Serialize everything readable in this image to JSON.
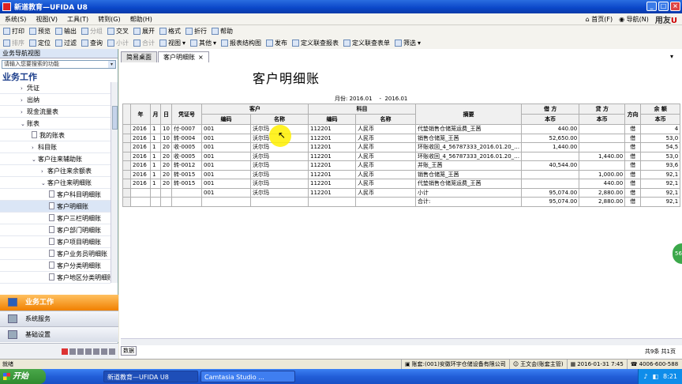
{
  "window": {
    "title": "新道教育—UFIDA U8"
  },
  "menu": [
    "系统(S)",
    "视图(V)",
    "工具(T)",
    "转到(G)",
    "帮助(H)"
  ],
  "menu_right": {
    "home": "首页(F)",
    "nav": "导航(N)",
    "logo_a": "用友",
    "logo_b": "U"
  },
  "toolbar1": [
    "打印",
    "预览",
    "输出",
    "分组",
    "交叉",
    "展开",
    "格式",
    "折行",
    "帮助"
  ],
  "toolbar2": [
    "排序",
    "定位",
    "过滤",
    "查询",
    "小计",
    "合计",
    "视图",
    "其他",
    "报表结构图",
    "发布",
    "定义联查报表",
    "定义联查表单",
    "筛选"
  ],
  "sidebar": {
    "header": "业务导航视图",
    "search_placeholder": "请输入您要搜索的功能",
    "title": "业务工作",
    "tree": [
      {
        "label": "凭证",
        "arrow": "›"
      },
      {
        "label": "出纳",
        "arrow": "›"
      },
      {
        "label": "现金流量表",
        "arrow": "›"
      },
      {
        "label": "账表",
        "arrow": "⌄"
      },
      {
        "label": "我的账表",
        "arrow": ""
      },
      {
        "label": "科目账",
        "arrow": "›"
      },
      {
        "label": "客户往来辅助账",
        "arrow": "⌄"
      },
      {
        "label": "客户往来余额表",
        "arrow": "›"
      },
      {
        "label": "客户往来明细账",
        "arrow": "⌄"
      },
      {
        "label": "客户科目明细账",
        "arrow": ""
      },
      {
        "label": "客户明细账",
        "arrow": ""
      },
      {
        "label": "客户三栏明细账",
        "arrow": ""
      },
      {
        "label": "客户部门明细账",
        "arrow": ""
      },
      {
        "label": "客户项目明细账",
        "arrow": ""
      },
      {
        "label": "客户业务员明细账",
        "arrow": ""
      },
      {
        "label": "客户分类明细账",
        "arrow": ""
      },
      {
        "label": "客户地区分类明细账",
        "arrow": ""
      }
    ],
    "nav_big": "业务工作",
    "nav_items": [
      "系统服务",
      "基础设置"
    ]
  },
  "tabs": [
    "简易桌面",
    "客户明细账"
  ],
  "report": {
    "title": "客户明细账",
    "month_label": "月份:",
    "month_from": "2016.01",
    "month_sep": "-",
    "month_to": "2016.01",
    "headers_top": [
      "年",
      "月",
      "日",
      "凭证号",
      "客户",
      "科目",
      "摘要",
      "借 方",
      "贷 方",
      "方向",
      "余 额"
    ],
    "headers_sub": [
      "编码",
      "名称",
      "编码",
      "名称",
      "本币",
      "本币",
      "本币"
    ],
    "rows": [
      [
        "2016",
        "1",
        "10",
        "付-0007",
        "001",
        "沃尔玛",
        "112201",
        "人民币",
        "代垫销售仓储笼运费_王茜",
        "440.00",
        "",
        "借",
        "4"
      ],
      [
        "2016",
        "1",
        "10",
        "转-0004",
        "001",
        "沃尔玛",
        "112201",
        "人民币",
        "销售仓储笼_王茜",
        "52,650.00",
        "",
        "借",
        "53,0"
      ],
      [
        "2016",
        "1",
        "20",
        "收-0005",
        "001",
        "沃尔玛",
        "112201",
        "人民币",
        "环账收回_4_56787333_2016.01.20_…",
        "1,440.00",
        "",
        "借",
        "54,5"
      ],
      [
        "2016",
        "1",
        "20",
        "收-0005",
        "001",
        "沃尔玛",
        "112201",
        "人民币",
        "环账收回_4_56787333_2016.01.20_…",
        "",
        "1,440.00",
        "借",
        "53,0"
      ],
      [
        "2016",
        "1",
        "20",
        "转-0012",
        "001",
        "沃尔玛",
        "112201",
        "人民币",
        "并账_王茜",
        "40,544.00",
        "",
        "借",
        "93,6"
      ],
      [
        "2016",
        "1",
        "20",
        "转-0015",
        "001",
        "沃尔玛",
        "112201",
        "人民币",
        "销售仓储笼_王茜",
        "",
        "1,000.00",
        "借",
        "92,1"
      ],
      [
        "2016",
        "1",
        "20",
        "转-0015",
        "001",
        "沃尔玛",
        "112201",
        "人民币",
        "代垫销售仓储笼运费_王茜",
        "",
        "440.00",
        "借",
        "92,1"
      ],
      [
        "",
        "",
        "",
        "",
        "001",
        "沃尔玛",
        "112201",
        "人民币",
        "小计",
        "95,074.00",
        "2,880.00",
        "借",
        "92,1"
      ],
      [
        "",
        "",
        "",
        "",
        "",
        "",
        "",
        "",
        "合计:",
        "95,074.00",
        "2,880.00",
        "借",
        "92,1"
      ]
    ]
  },
  "bottom_tab": "数据",
  "page_info": "共9条 共1页",
  "status": {
    "ready": "就绪",
    "account": "账套:(001)安徽环宇仓储设备有限公司",
    "user": "王文会(账套主管)",
    "datetime": "2016-01-31 7:45",
    "phone": "4006-600-588"
  },
  "taskbar": {
    "start": "开始",
    "tasks": [
      "新道教育—UFIDA U8",
      "Camtasia Studio ..."
    ],
    "clock": "8:21"
  },
  "edge_badge": "56"
}
